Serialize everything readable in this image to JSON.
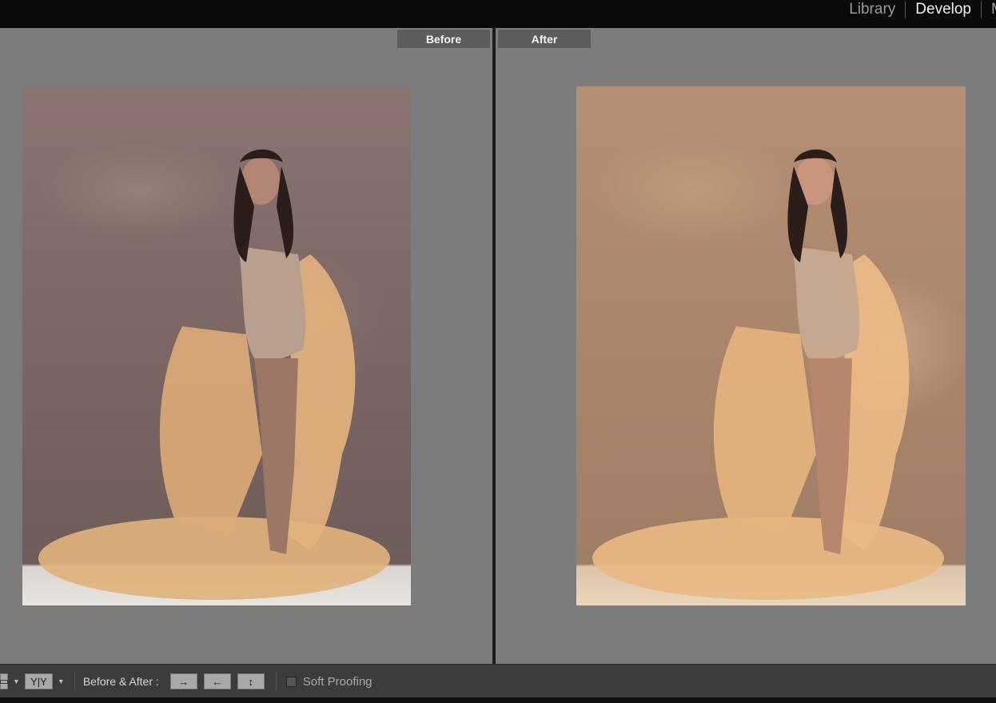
{
  "module_nav": {
    "items": [
      {
        "label": "Library",
        "active": false
      },
      {
        "label": "Develop",
        "active": true
      },
      {
        "label": "M",
        "active": false
      }
    ]
  },
  "panes": {
    "before_label": "Before",
    "after_label": "After"
  },
  "toolbar": {
    "view_mode_label": "Y|Y",
    "before_after_label": "Before & After :",
    "swap_left_to_right_icon": "arrow-right-icon",
    "swap_right_to_left_icon": "arrow-left-icon",
    "swap_settings_icon": "swap-vertical-icon",
    "soft_proofing_label": "Soft Proofing",
    "soft_proofing_checked": false
  },
  "colors": {
    "topbar": "#0a0a0a",
    "pane_bg": "#7c7c7c",
    "label_bg": "#5c5c5c",
    "toolbar_bg": "#3c3c3c",
    "active_module": "#f2f2f2",
    "inactive_module": "#9a9a9a"
  }
}
